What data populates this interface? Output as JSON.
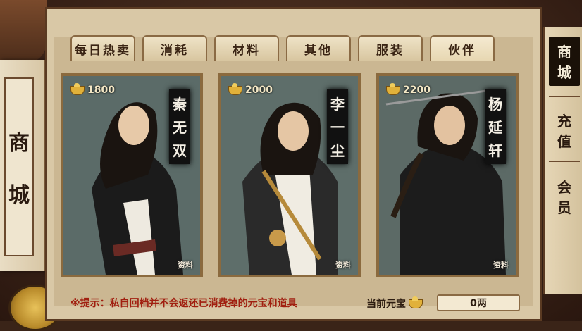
{
  "tabs": [
    {
      "label": "每日热卖"
    },
    {
      "label": "消耗"
    },
    {
      "label": "材料"
    },
    {
      "label": "其他"
    },
    {
      "label": "服装"
    },
    {
      "label": "伙伴"
    }
  ],
  "active_tab": "伙伴",
  "left_title": {
    "char1": "商",
    "char2": "城"
  },
  "cards": [
    {
      "price": "1800",
      "name": [
        "秦",
        "无",
        "双"
      ],
      "tag": "资料"
    },
    {
      "price": "2000",
      "name": [
        "李",
        "一",
        "尘"
      ],
      "tag": "资料"
    },
    {
      "price": "2200",
      "name": [
        "杨",
        "延",
        "轩"
      ],
      "tag": "资料"
    }
  ],
  "tip": "※提示：私自回档并不会返还已消费掉的元宝和道具",
  "currency": {
    "label": "当前元宝",
    "value": "0两"
  },
  "right_nav": [
    {
      "c1": "商",
      "c2": "城"
    },
    {
      "c1": "充",
      "c2": "值"
    },
    {
      "c1": "会",
      "c2": "员"
    }
  ],
  "icons": {
    "currency": "gold-ingot-icon"
  }
}
